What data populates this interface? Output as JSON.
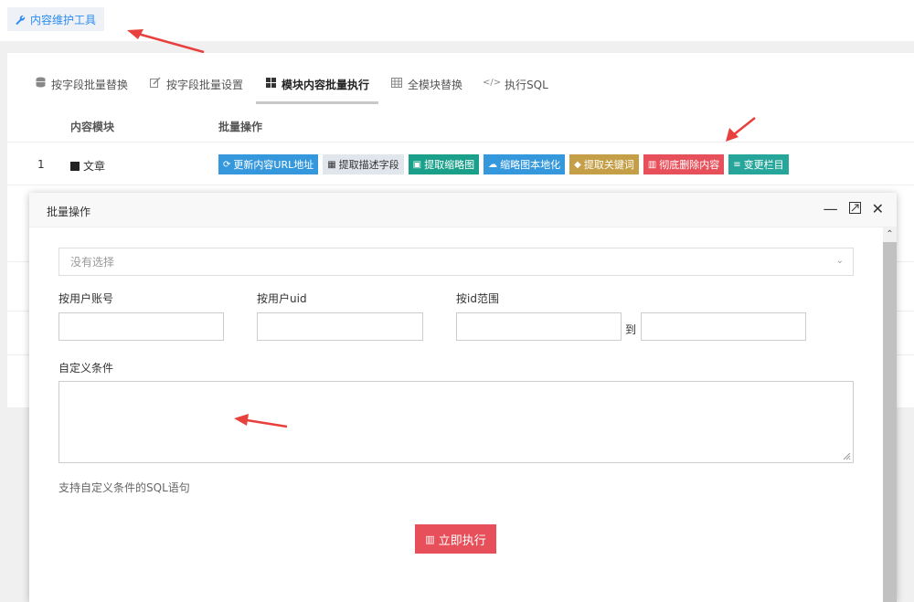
{
  "topbar": {
    "tool_label": "内容维护工具"
  },
  "tabs": [
    {
      "label": "按字段批量替换",
      "icon": "database-icon"
    },
    {
      "label": "按字段批量设置",
      "icon": "edit-icon"
    },
    {
      "label": "模块内容批量执行",
      "icon": "grid-icon"
    },
    {
      "label": "全模块替换",
      "icon": "table-icon"
    },
    {
      "label": "执行SQL",
      "icon": "code-icon"
    }
  ],
  "table": {
    "headers": [
      "内容模块",
      "批量操作"
    ],
    "rows": [
      {
        "num": "1",
        "module": "文章"
      }
    ],
    "ops": [
      "更新内容URL地址",
      "提取描述字段",
      "提取缩略图",
      "缩略图本地化",
      "提取关键词",
      "彻底删除内容",
      "变更栏目"
    ]
  },
  "modal": {
    "title": "批量操作",
    "select_placeholder": "没有选择",
    "label_account": "按用户账号",
    "label_uid": "按用户uid",
    "label_idrange": "按id范围",
    "to_text": "到",
    "label_custom": "自定义条件",
    "help_text": "支持自定义条件的SQL语句",
    "execute_label": "立即执行"
  },
  "colors": {
    "primary": "#2d8cf0",
    "blue": "#3598dc",
    "teal": "#1a9f8a",
    "orange": "#c49f47",
    "red": "#e7505a",
    "green": "#26a69a",
    "arrow": "#e8403c"
  }
}
